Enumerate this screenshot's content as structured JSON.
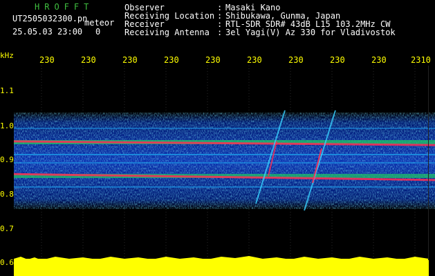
{
  "header": {
    "brand": "HROFFT",
    "filename": "UT2505032300.pn",
    "type_label": "meteor",
    "datetime": "25.05.03 23:00",
    "digit": "0"
  },
  "info": [
    {
      "label": "Observer",
      "value": "Masaki Kano"
    },
    {
      "label": "Receiving Location",
      "value": "Shibukawa, Gunma, Japan"
    },
    {
      "label": "Receiver",
      "value": "RTL-SDR SDR# 43dB L15 103.2MHz CW"
    },
    {
      "label": "Receiving Antenna",
      "value": "3el Yagi(V) Az 330 for Vladivostok"
    }
  ],
  "axis": {
    "y_unit": "kHz",
    "time_ticks": [
      "230",
      "230",
      "230",
      "230",
      "230",
      "230",
      "230",
      "230",
      "230",
      "2310"
    ],
    "freq_ticks": [
      "1.1",
      "1.0",
      "0.9",
      "0.8",
      "0.7",
      "0.6"
    ]
  }
}
